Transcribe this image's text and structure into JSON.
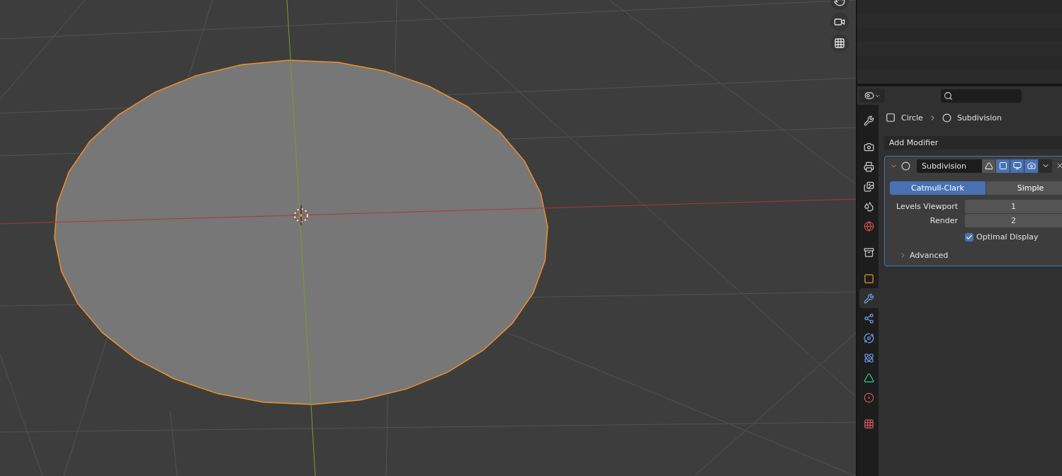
{
  "properties": {
    "tabs": [
      {
        "kind": "tool",
        "selected": false
      },
      {
        "kind": "render",
        "selected": false
      },
      {
        "kind": "output",
        "selected": false
      },
      {
        "kind": "view_layer",
        "selected": false
      },
      {
        "kind": "scene",
        "selected": false
      },
      {
        "kind": "world",
        "selected": false
      },
      {
        "kind": "collection",
        "selected": false
      },
      {
        "kind": "object",
        "selected": false
      },
      {
        "kind": "modifiers",
        "selected": true
      },
      {
        "kind": "particles",
        "selected": false
      },
      {
        "kind": "physics",
        "selected": false
      },
      {
        "kind": "constraints",
        "selected": false
      },
      {
        "kind": "data",
        "selected": false
      },
      {
        "kind": "material",
        "selected": false
      },
      {
        "kind": "texture",
        "selected": false
      }
    ],
    "breadcrumb": [
      "Circle",
      "Subdivision"
    ],
    "add_modifier": "Add Modifier",
    "modifier": {
      "name": "Subdivision",
      "expanded": true,
      "toggles": [
        {
          "kind": "edit_mode",
          "on": false
        },
        {
          "kind": "cage",
          "on": true
        },
        {
          "kind": "viewport",
          "on": true
        },
        {
          "kind": "render",
          "on": true
        }
      ],
      "types": [
        {
          "label": "Catmull-Clark",
          "selected": true
        },
        {
          "label": "Simple",
          "selected": false
        }
      ],
      "fields": [
        {
          "label": "Levels Viewport",
          "value": "1"
        },
        {
          "label": "Render",
          "value": "2"
        }
      ],
      "optimal_display": {
        "label": "Optimal Display",
        "checked": true
      },
      "advanced": {
        "label": "Advanced",
        "expanded": false
      }
    }
  }
}
